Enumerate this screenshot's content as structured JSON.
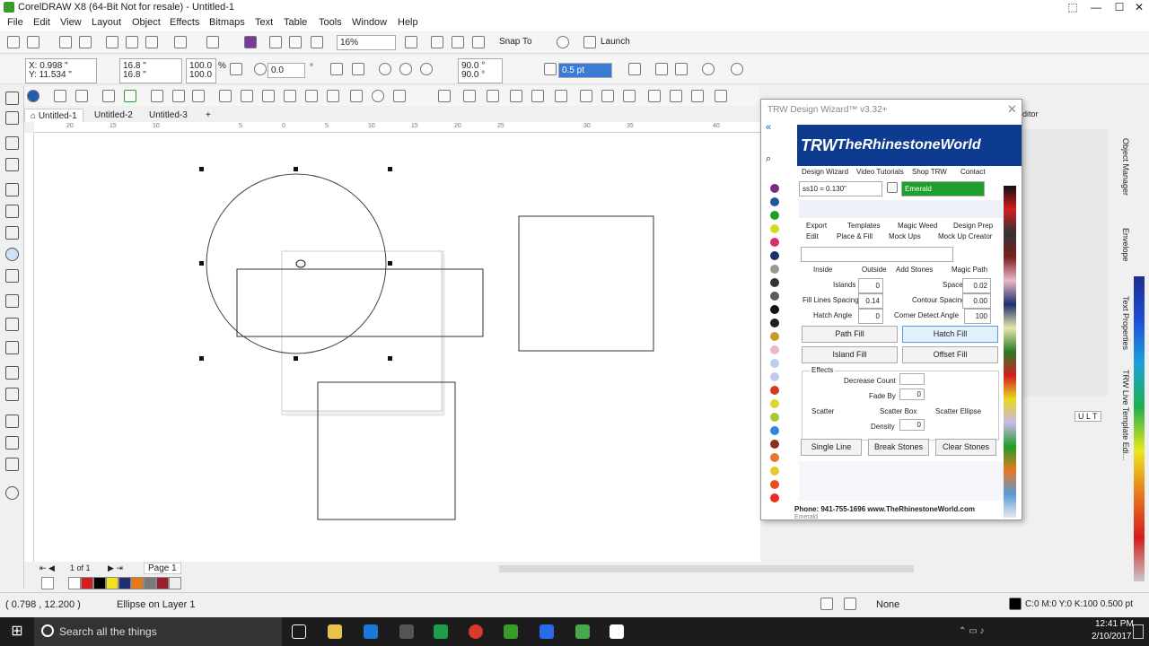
{
  "app": {
    "title": "CorelDRAW X8 (64-Bit Not for resale) - Untitled-1"
  },
  "menu": [
    "File",
    "Edit",
    "View",
    "Layout",
    "Object",
    "Effects",
    "Bitmaps",
    "Text",
    "Table",
    "Tools",
    "Window",
    "Help"
  ],
  "toolbar": {
    "zoom": "16%",
    "snap": "Snap To",
    "launch": "Launch"
  },
  "props": {
    "x": "X: 0.998 \"",
    "y": "Y: 11.534 \"",
    "w": "16.8 \"",
    "h": "16.8 \"",
    "sw": "100.0",
    "sh": "100.0",
    "pct": "%",
    "angle": "0.0",
    "deg": "°",
    "a1": "90.0 °",
    "a2": "90.0 °",
    "outline": "0.5 pt"
  },
  "tabs": [
    "Untitled-1",
    "Untitled-2",
    "Untitled-3"
  ],
  "ruler": [
    "20",
    "15",
    "10",
    "5",
    "0",
    "5",
    "10",
    "15",
    "20",
    "25",
    "30",
    "35",
    "40"
  ],
  "page_nav": {
    "of": "1   of   1",
    "page": "Page 1"
  },
  "status": {
    "coords": "( 0.798 , 12.200 )",
    "object": "Ellipse on Layer 1",
    "fill": "None",
    "outline": "C:0 M:0 Y:0 K:100  0.500 pt"
  },
  "taskbar": {
    "search": "Search all the things",
    "time": "12:41 PM",
    "date": "2/10/2017"
  },
  "trw": {
    "title": "TRW Design Wizard™ v3.32+",
    "banner": "TheRhinestoneWorld",
    "banner_logo": "TRW",
    "tabs1": [
      "Design Wizard",
      "Video Tutorials",
      "Shop TRW",
      "Contact"
    ],
    "stone_size": "ss10 = 0.130\"",
    "color_name": "Emerald",
    "tabs2": [
      "Export",
      "Templates",
      "Magic Weed",
      "Design Prep"
    ],
    "tabs3": [
      "Edit",
      "Place & Fill",
      "Mock Ups",
      "Mock Up Creator"
    ],
    "opt_inside": "Inside",
    "opt_outside": "Outside",
    "add_stones": "Add Stones",
    "magic_path": "Magic Path",
    "islands_lbl": "Islands",
    "islands": "0",
    "space_lbl": "Space",
    "space": "0.02",
    "fls_lbl": "Fill Lines Spacing",
    "fls": "0.14",
    "cs_lbl": "Contour Spacing",
    "cs": "0.00",
    "ha_lbl": "Hatch Angle",
    "ha": "0",
    "cda_lbl": "Corner Detect Angle",
    "cda": "100",
    "buttons": [
      "Path Fill",
      "Hatch Fill",
      "Island Fill",
      "Offset Fill"
    ],
    "effects": "Effects",
    "dec": "Decrease Count",
    "fade": "Fade By",
    "fade_v": "0",
    "scatter": "Scatter",
    "sbox": "Scatter Box",
    "sellipse": "Scatter Ellipse",
    "density": "Density",
    "density_v": "0",
    "bottom_buttons": [
      "Single Line",
      "Break Stones",
      "Clear Stones"
    ],
    "phone": "Phone: 941-755-1696  www.TheRhinestoneWorld.com",
    "footer": "Emerald"
  },
  "docker": {
    "titles": [
      "Object Manager",
      "Envelope",
      "Text Properties",
      "TRW Live Template Edi..."
    ],
    "partial": "ditor",
    "ult": "U L T"
  },
  "colors": {
    "accent": "#0d3b8f",
    "emerald": "#1e9e2a"
  }
}
